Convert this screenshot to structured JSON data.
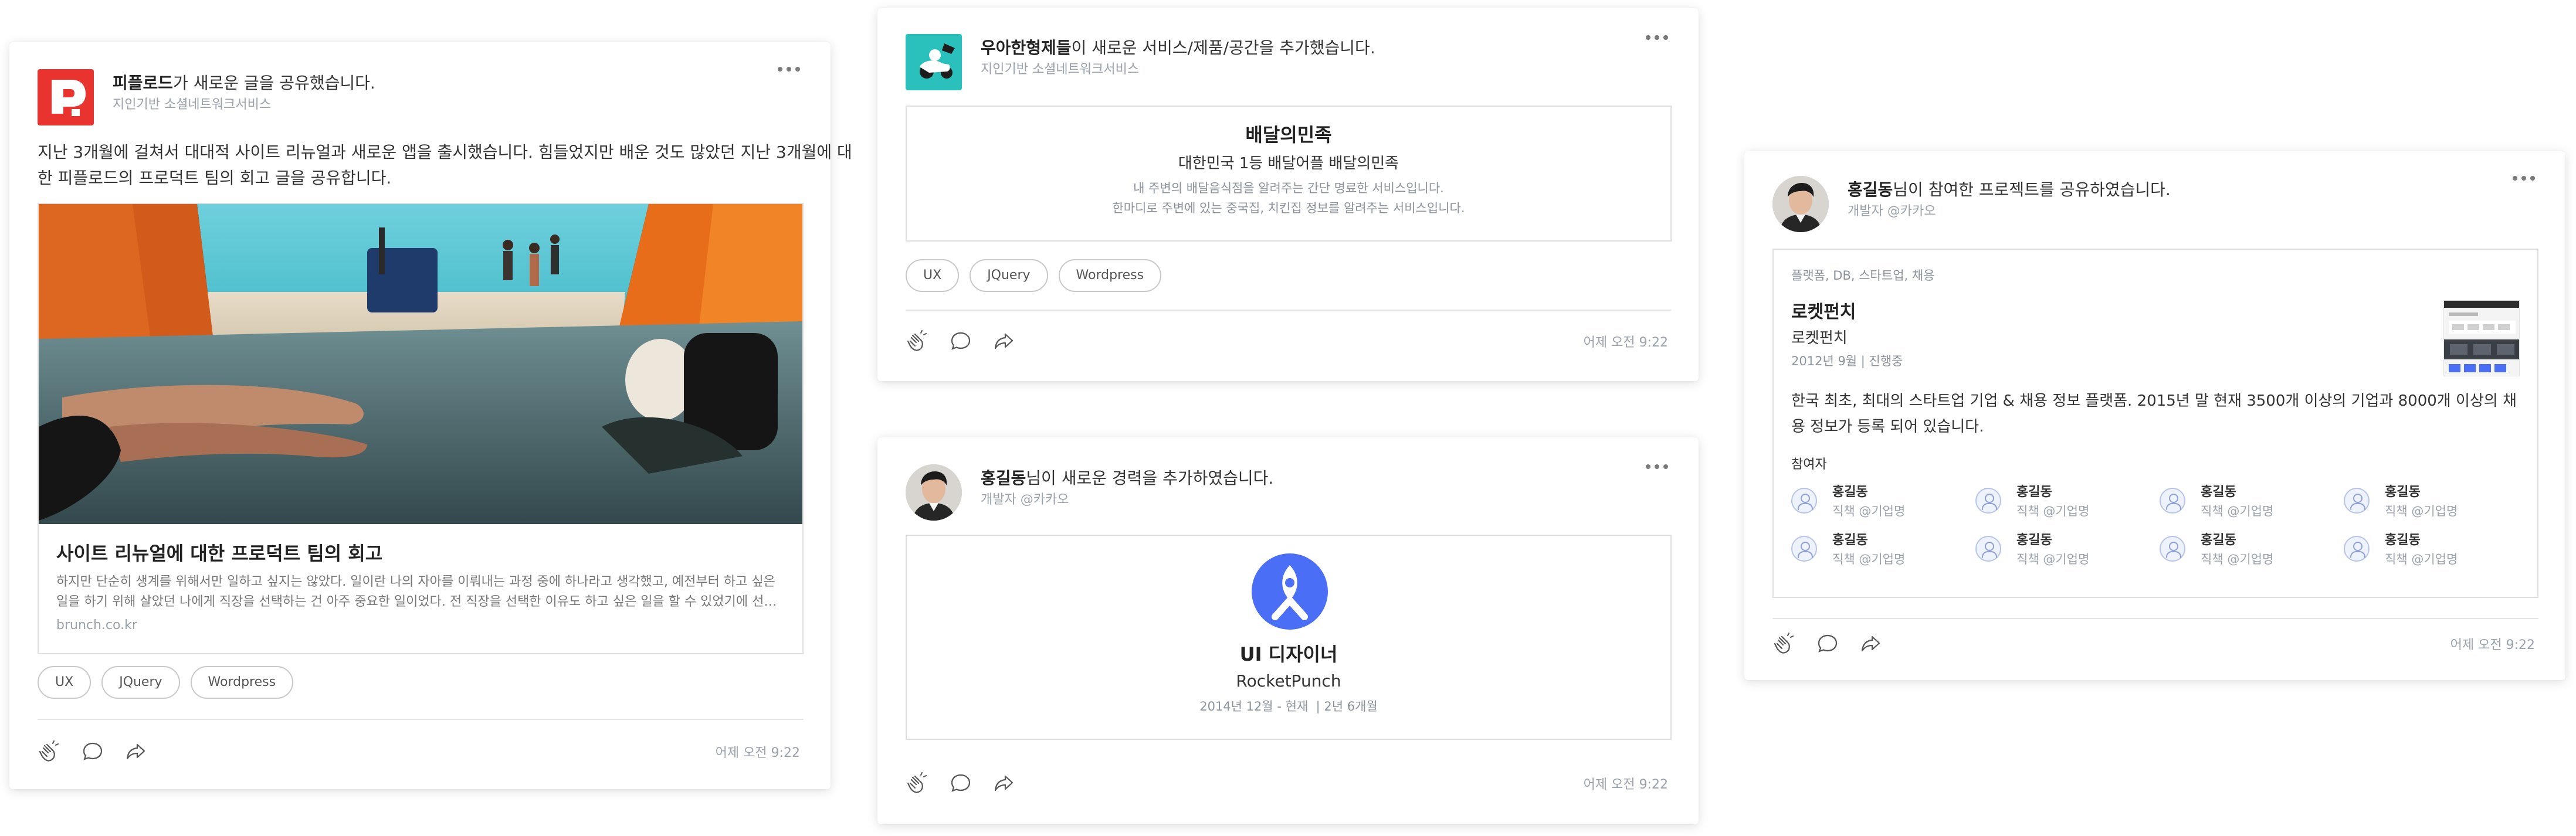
{
  "colors": {
    "card_border": "#dedede",
    "meta_text": "#9aa2ae",
    "logo_red": "#e8332e",
    "brand_teal": "#2ac1bc",
    "rocketpunch_blue": "#4a6ef5"
  },
  "common": {
    "more_icon": "more-horizontal-icon",
    "action_icons": [
      "clap-icon",
      "comment-icon",
      "share-icon"
    ],
    "time": "어제 오전 9:22"
  },
  "card1": {
    "org_name": "피플로드",
    "action": "가 새로운 글을 공유했습니다.",
    "subtitle": "지인기반 소셜네트워크서비스",
    "body_line1": "지난 3개월에 걸쳐서 대대적 사이트 리뉴얼과 새로운 앱을 출시했습니다. 힘들었지만 배운 것도 많았던 지난 3개월에 대",
    "body_line2": "한 피플로드의 프로덕트 팀의 회고 글을 공유합니다.",
    "link": {
      "title": "사이트 리뉴얼에 대한 프로덕트 팀의 회고",
      "desc_line1": "하지만 단순히 생계를 위해서만 일하고 싶지는 않았다. 일이란 나의 자아를 이뤄내는 과정 중에 하나라고 생각했고, 예전부터 하고 싶은",
      "desc_line2": "일을 하기 위해 살았던 나에게 직장을 선택하는 건 아주 중요한 일이었다. 전 직장을 선택한 이유도 하고 싶은 일을 할 수 있었기에 선…",
      "domain": "brunch.co.kr"
    },
    "tags": [
      "UX",
      "JQuery",
      "Wordpress"
    ]
  },
  "card2": {
    "org_name": "우아한형제들",
    "action": "이 새로운 서비스/제품/공간을 추가했습니다.",
    "subtitle": "지인기반 소셜네트워크서비스",
    "service": {
      "name": "배달의민족",
      "tagline": "대한민국 1등 배달어플 배달의민족",
      "desc_line1": "내 주변의 배달음식점을 알려주는 간단 명료한 서비스입니다.",
      "desc_line2": "한마디로 주변에 있는 중국집, 치킨집 정보를 알려주는 서비스입니다."
    },
    "tags": [
      "UX",
      "JQuery",
      "Wordpress"
    ]
  },
  "card3": {
    "user_name": "홍길동",
    "action": "님이 새로운 경력을 추가하였습니다.",
    "subtitle": "개발자 @카카오",
    "career": {
      "position": "UI 디자이너",
      "company": "RocketPunch",
      "period": "2014년 12월 - 현재",
      "separator": "|",
      "duration": "2년 6개월"
    }
  },
  "card4": {
    "user_name": "홍길동",
    "action": "님이 참여한 프로젝트를 공유하였습니다.",
    "subtitle": "개발자 @카카오",
    "project": {
      "categories": "플랫폼, DB, 스타트업, 채용",
      "title": "로켓펀치",
      "subtitle": "로켓펀치",
      "meta": "2012년 9월 | 진행중",
      "desc_line1": "한국 최초, 최대의 스타트업 기업 & 채용 정보 플랫폼. 2015년 말 현재 3500개 이상의 기업과 8000개 이상의 채",
      "desc_line2": "용 정보가 등록 되어 있습니다.",
      "participants_label": "참여자",
      "participants": [
        {
          "name": "홍길동",
          "role": "직책 @기업명"
        },
        {
          "name": "홍길동",
          "role": "직책 @기업명"
        },
        {
          "name": "홍길동",
          "role": "직책 @기업명"
        },
        {
          "name": "홍길동",
          "role": "직책 @기업명"
        },
        {
          "name": "홍길동",
          "role": "직책 @기업명"
        },
        {
          "name": "홍길동",
          "role": "직책 @기업명"
        },
        {
          "name": "홍길동",
          "role": "직책 @기업명"
        },
        {
          "name": "홍길동",
          "role": "직책 @기업명"
        }
      ]
    }
  }
}
